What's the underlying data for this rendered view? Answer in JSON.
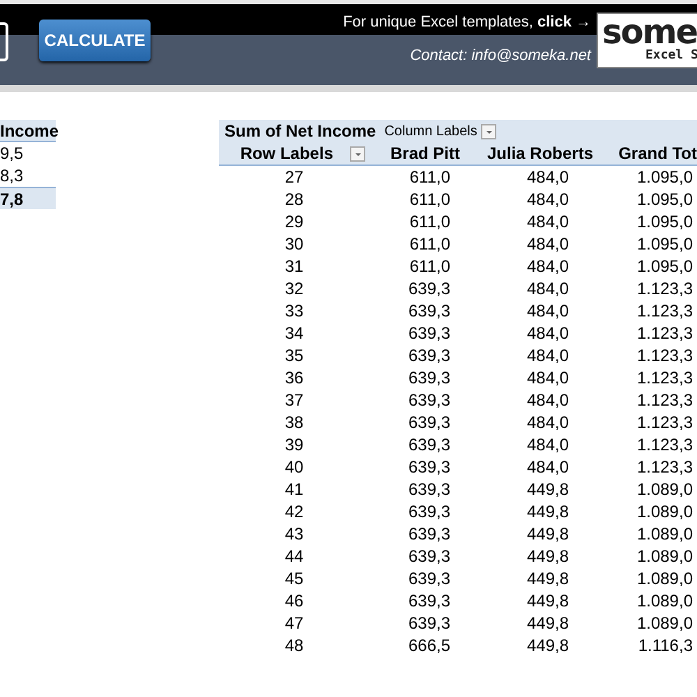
{
  "header": {
    "button": "CALCULATE",
    "promo_text": "For unique Excel templates, ",
    "promo_link": "click →",
    "contact": "Contact: info@someka.net",
    "logo": "some",
    "logo_sub": "Excel S"
  },
  "left_pivot": {
    "heading": "Income",
    "rows": [
      {
        "value": "9,5",
        "kind": "item"
      },
      {
        "value": "8,3",
        "kind": "item"
      },
      {
        "value": "7,8",
        "kind": "total"
      }
    ]
  },
  "pivot": {
    "title": "Sum of Net Income",
    "column_labels": "Column Labels",
    "columns": [
      "Row Labels",
      "Brad Pitt",
      "Julia Roberts",
      "Grand Tot"
    ],
    "rows": [
      [
        "27",
        "611,0",
        "484,0",
        "1.095,0"
      ],
      [
        "28",
        "611,0",
        "484,0",
        "1.095,0"
      ],
      [
        "29",
        "611,0",
        "484,0",
        "1.095,0"
      ],
      [
        "30",
        "611,0",
        "484,0",
        "1.095,0"
      ],
      [
        "31",
        "611,0",
        "484,0",
        "1.095,0"
      ],
      [
        "32",
        "639,3",
        "484,0",
        "1.123,3"
      ],
      [
        "33",
        "639,3",
        "484,0",
        "1.123,3"
      ],
      [
        "34",
        "639,3",
        "484,0",
        "1.123,3"
      ],
      [
        "35",
        "639,3",
        "484,0",
        "1.123,3"
      ],
      [
        "36",
        "639,3",
        "484,0",
        "1.123,3"
      ],
      [
        "37",
        "639,3",
        "484,0",
        "1.123,3"
      ],
      [
        "38",
        "639,3",
        "484,0",
        "1.123,3"
      ],
      [
        "39",
        "639,3",
        "484,0",
        "1.123,3"
      ],
      [
        "40",
        "639,3",
        "484,0",
        "1.123,3"
      ],
      [
        "41",
        "639,3",
        "449,8",
        "1.089,0"
      ],
      [
        "42",
        "639,3",
        "449,8",
        "1.089,0"
      ],
      [
        "43",
        "639,3",
        "449,8",
        "1.089,0"
      ],
      [
        "44",
        "639,3",
        "449,8",
        "1.089,0"
      ],
      [
        "45",
        "639,3",
        "449,8",
        "1.089,0"
      ],
      [
        "46",
        "639,3",
        "449,8",
        "1.089,0"
      ],
      [
        "47",
        "639,3",
        "449,8",
        "1.089,0"
      ],
      [
        "48",
        "666,5",
        "449,8",
        "1.116,3"
      ]
    ]
  }
}
